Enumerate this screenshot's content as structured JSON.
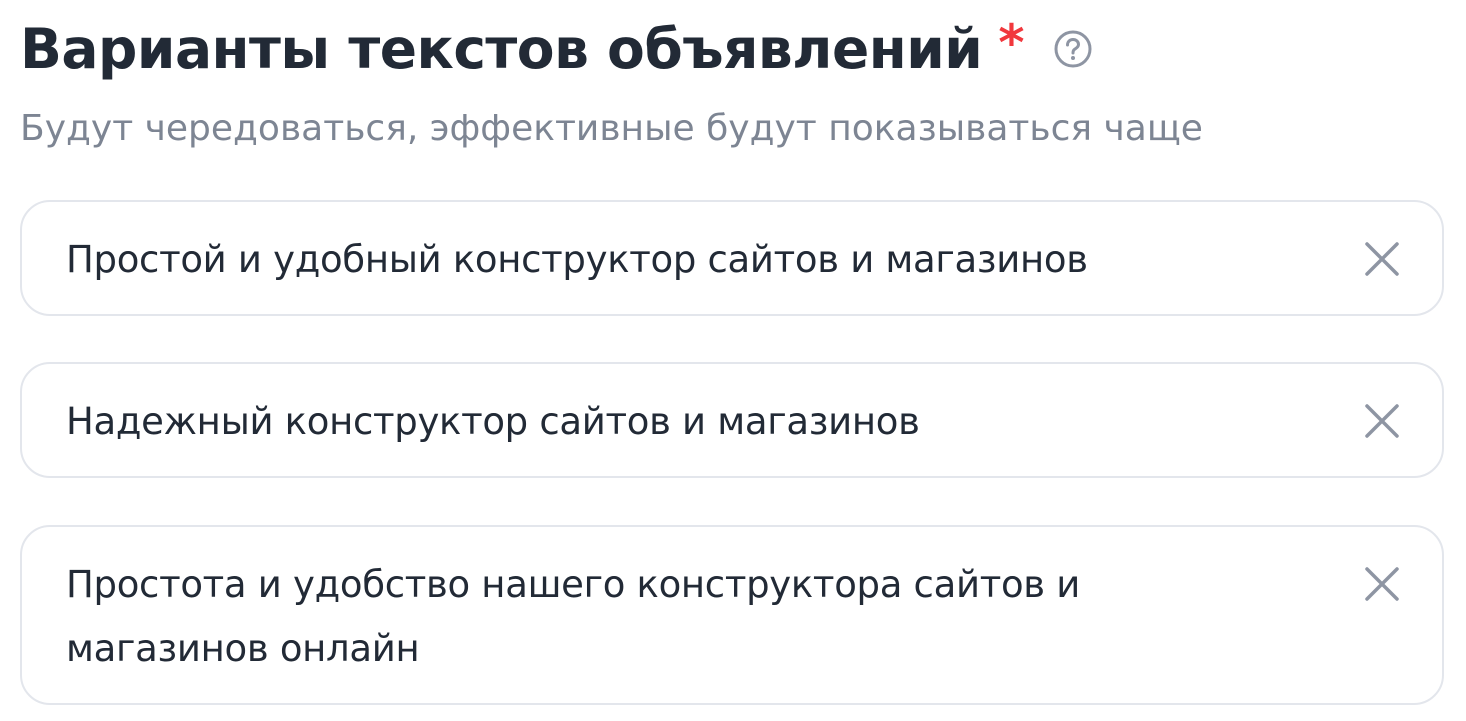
{
  "section": {
    "title": "Варианты текстов объявлений",
    "required_mark": "*",
    "help_icon": "question-circle-icon",
    "subtitle": "Будут чередоваться, эффективные будут показываться чаще"
  },
  "variants": [
    {
      "text": "Простой и удобный конструктор сайтов и магазинов",
      "clear_icon": "close-icon"
    },
    {
      "text": "Надежный конструктор сайтов и магазинов",
      "clear_icon": "close-icon"
    },
    {
      "text": "Простота и удобство нашего конструктора сайтов и магазинов онлайн",
      "clear_icon": "close-icon"
    }
  ],
  "colors": {
    "title": "#222a36",
    "required": "#f1383d",
    "subtitle": "#7d8593",
    "border": "#e3e6ec",
    "icon": "#8e95a3"
  }
}
